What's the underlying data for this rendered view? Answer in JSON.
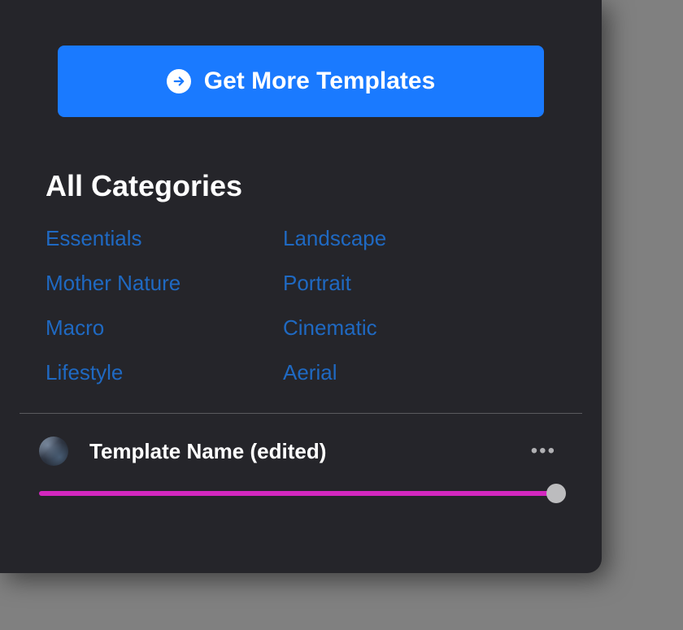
{
  "actions": {
    "get_more_templates_label": "Get More Templates"
  },
  "section_title": "All Categories",
  "categories": [
    "Essentials",
    "Landscape",
    "Mother Nature",
    "Portrait",
    "Macro",
    "Cinematic",
    "Lifestyle",
    "Aerial"
  ],
  "template": {
    "name": "Template Name (edited)",
    "slider_value": 100
  }
}
